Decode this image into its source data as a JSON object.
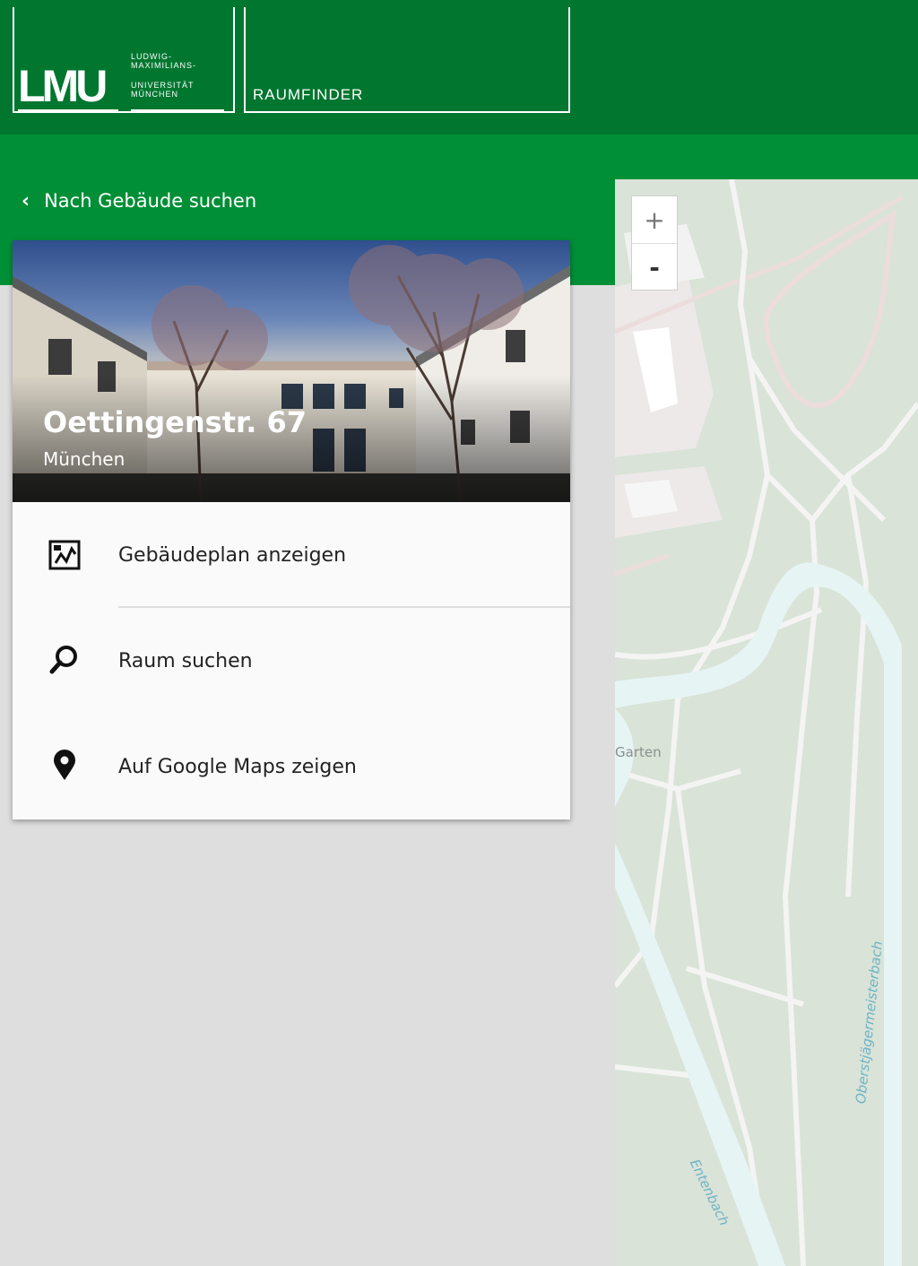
{
  "header": {
    "logo_text": "LMU",
    "logo_lines": [
      "LUDWIG-",
      "MAXIMILIANS-",
      "UNIVERSITÄT",
      "MÜNCHEN"
    ],
    "app_title": "RAUMFINDER"
  },
  "nav": {
    "back_label": "Nach Gebäude suchen",
    "back_icon": "chevron-left-icon"
  },
  "building": {
    "name": "Oettingenstr. 67",
    "city": "München"
  },
  "menu": {
    "items": [
      {
        "label": "Gebäudeplan anzeigen",
        "icon": "building-plan-icon"
      },
      {
        "label": "Raum suchen",
        "icon": "search-icon"
      },
      {
        "label": "Auf Google Maps zeigen",
        "icon": "map-pin-icon"
      }
    ]
  },
  "map": {
    "zoom_in": "+",
    "zoom_out": "-",
    "labels": {
      "garden": "Garten",
      "creek": "Entenbach",
      "river": "Oberstjägermeisterbach"
    }
  },
  "colors": {
    "header_dark": "#00762f",
    "header_band": "#008f36",
    "map_bg": "#d9e3d8",
    "water": "#e6f4f4",
    "page_bg": "#dedede"
  }
}
